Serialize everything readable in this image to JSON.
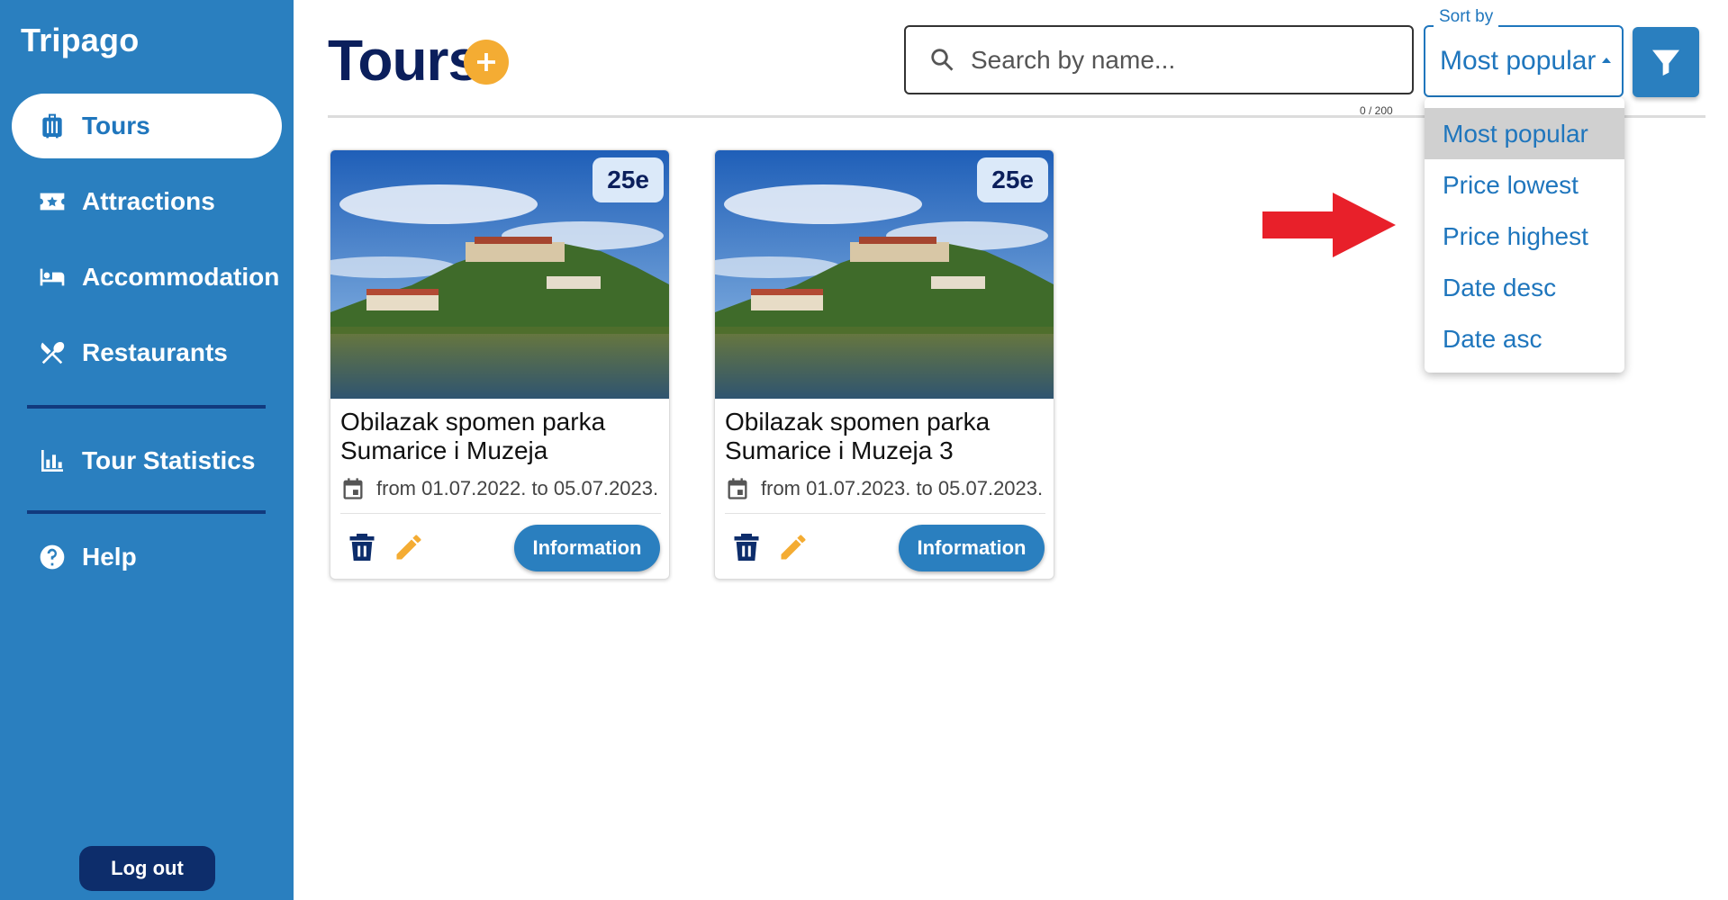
{
  "sidebar": {
    "brand": "Tripago",
    "items": [
      {
        "label": "Tours",
        "icon": "suitcase-icon",
        "active": true
      },
      {
        "label": "Attractions",
        "icon": "ticket-star-icon",
        "active": false
      },
      {
        "label": "Accommodation",
        "icon": "bed-icon",
        "active": false
      },
      {
        "label": "Restaurants",
        "icon": "fork-knife-icon",
        "active": false
      },
      {
        "label": "Tour Statistics",
        "icon": "bar-chart-icon",
        "active": false
      },
      {
        "label": "Help",
        "icon": "help-circle-icon",
        "active": false
      }
    ],
    "logout_label": "Log out"
  },
  "header": {
    "title": "Tours",
    "add_icon": "plus-circle-icon",
    "search": {
      "placeholder": "Search by name...",
      "value": "",
      "counter": "0 / 200"
    },
    "sort": {
      "label": "Sort by",
      "selected": "Most popular"
    },
    "filter_icon": "filter-icon"
  },
  "sort_dropdown": {
    "options": [
      "Most popular",
      "Price lowest",
      "Price highest",
      "Date desc",
      "Date asc"
    ],
    "selected_index": 0
  },
  "tours": [
    {
      "price": "25e",
      "title": "Obilazak spomen parka Sumarice i Muzeja",
      "dates": "from 01.07.2022. to 05.07.2023.",
      "info_label": "Information"
    },
    {
      "price": "25e",
      "title": "Obilazak spomen parka Sumarice i Muzeja 3",
      "dates": "from 01.07.2023. to 05.07.2023.",
      "info_label": "Information"
    }
  ],
  "colors": {
    "sidebar": "#2a7fbf",
    "accent": "#1f76bd",
    "title": "#0b1f5c",
    "add": "#f4ac33",
    "logout": "#0d2d6b",
    "arrow": "#e8202a"
  }
}
